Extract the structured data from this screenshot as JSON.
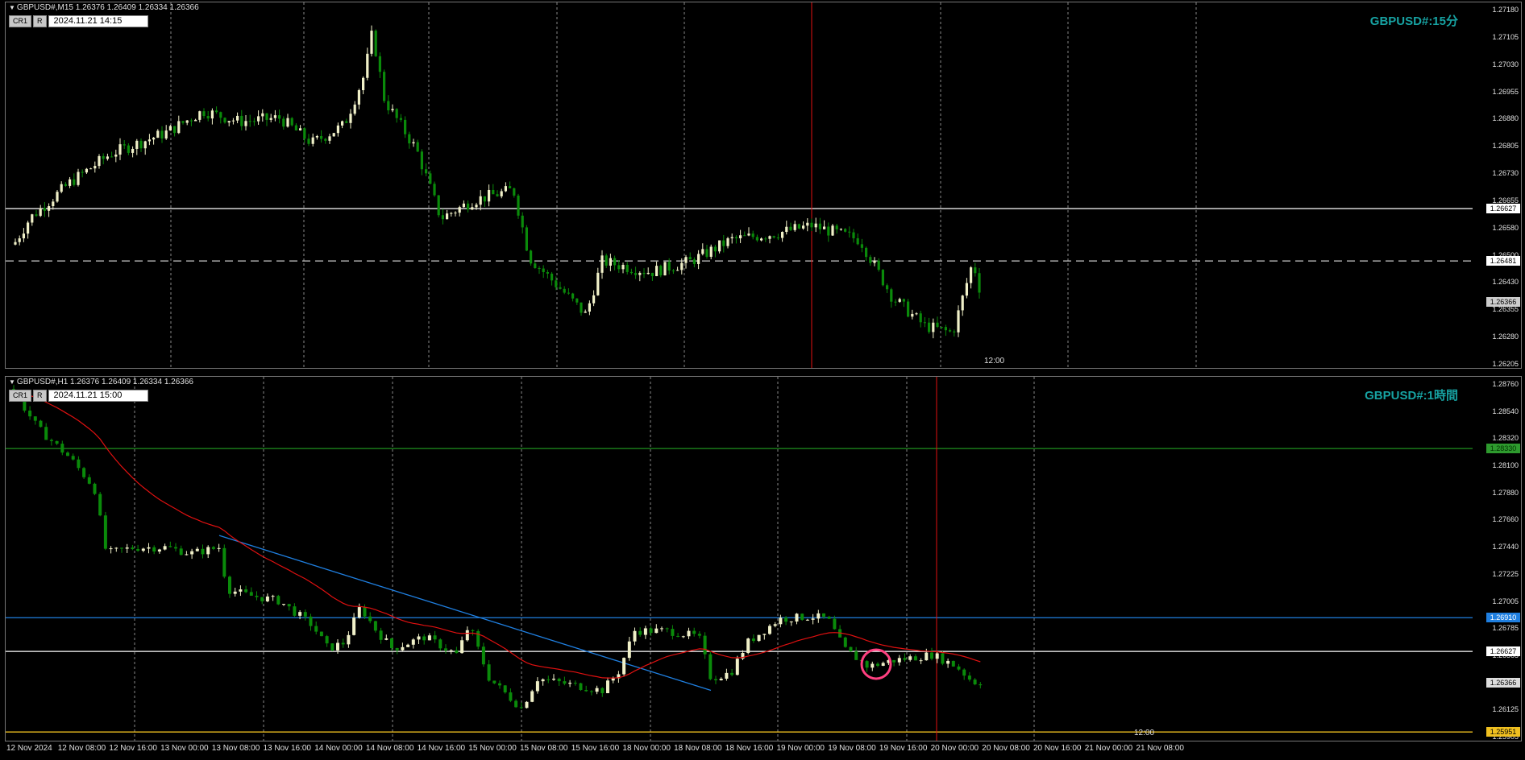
{
  "pane1": {
    "header": "GBPUSD#,M15  1.26376 1.26409 1.26334 1.26366",
    "buttons": [
      "CR1",
      "R"
    ],
    "datetime": "2024.11.21 14:15",
    "label": "GBPUSD#:15分",
    "price_labels": [
      "1.27180",
      "1.27105",
      "1.27030",
      "1.26955",
      "1.26880",
      "1.26805",
      "1.26730",
      "1.26655",
      "1.26580",
      "1.26500",
      "1.26430",
      "1.26355",
      "1.26280",
      "1.26205"
    ],
    "highlight_labels": [
      "1.26627",
      "1.26481",
      "1.26366"
    ],
    "cursor_label": "12:00",
    "price_range": [
      1.26205,
      1.2718
    ],
    "hlines": [
      {
        "price": 1.26627,
        "color": "#ffffff",
        "style": "solid"
      },
      {
        "price": 1.26481,
        "color": "#cccccc",
        "style": "dashed"
      }
    ]
  },
  "pane2": {
    "header": "GBPUSD#,H1  1.26376 1.26409 1.26334 1.26366",
    "buttons": [
      "CR1",
      "R"
    ],
    "datetime": "2024.11.21 15:00",
    "label": "GBPUSD#:1時間",
    "price_labels": [
      "1.28760",
      "1.28540",
      "1.28320",
      "1.28100",
      "1.27880",
      "1.27660",
      "1.27440",
      "1.27225",
      "1.27005",
      "1.26785",
      "1.26565",
      "1.26345",
      "1.26125",
      "1.25905"
    ],
    "highlight_labels": [
      {
        "text": "1.28330",
        "bg": "#2e9a2e",
        "fg": "#003300"
      },
      {
        "text": "1.26910",
        "bg": "#1f7fe0",
        "fg": "#ffffff"
      },
      {
        "text": "1.26627",
        "bg": "#ffffff",
        "fg": "#000000"
      },
      {
        "text": "1.26366",
        "bg": "#dddddd",
        "fg": "#000000"
      },
      {
        "text": "1.25951",
        "bg": "#f0c020",
        "fg": "#000000"
      }
    ],
    "cursor_label": "12:00",
    "price_range": [
      1.25905,
      1.28905
    ],
    "hlines": [
      {
        "price": 1.2833,
        "color": "#1f8f1f",
        "style": "solid"
      },
      {
        "price": 1.2691,
        "color": "#1f7fe0",
        "style": "solid"
      },
      {
        "price": 1.26627,
        "color": "#ffffff",
        "style": "solid"
      },
      {
        "price": 1.25951,
        "color": "#f0c020",
        "style": "solid"
      }
    ]
  },
  "time_axis": [
    "12 Nov 2024",
    "12 Nov 08:00",
    "12 Nov 16:00",
    "13 Nov 00:00",
    "13 Nov 08:00",
    "13 Nov 16:00",
    "14 Nov 00:00",
    "14 Nov 08:00",
    "14 Nov 16:00",
    "15 Nov 00:00",
    "15 Nov 08:00",
    "15 Nov 16:00",
    "18 Nov 00:00",
    "18 Nov 08:00",
    "18 Nov 16:00",
    "19 Nov 00:00",
    "19 Nov 08:00",
    "19 Nov 16:00",
    "20 Nov 00:00",
    "20 Nov 08:00",
    "20 Nov 16:00",
    "21 Nov 00:00",
    "21 Nov 08:00"
  ],
  "colors": {
    "bull": "#f0f0c8",
    "bear": "#0a8a0a",
    "ma": "#e01010",
    "trendline": "#1f7fe0",
    "cursor": "#e01010",
    "marker": "#ff4080",
    "grid": "#888888"
  }
}
